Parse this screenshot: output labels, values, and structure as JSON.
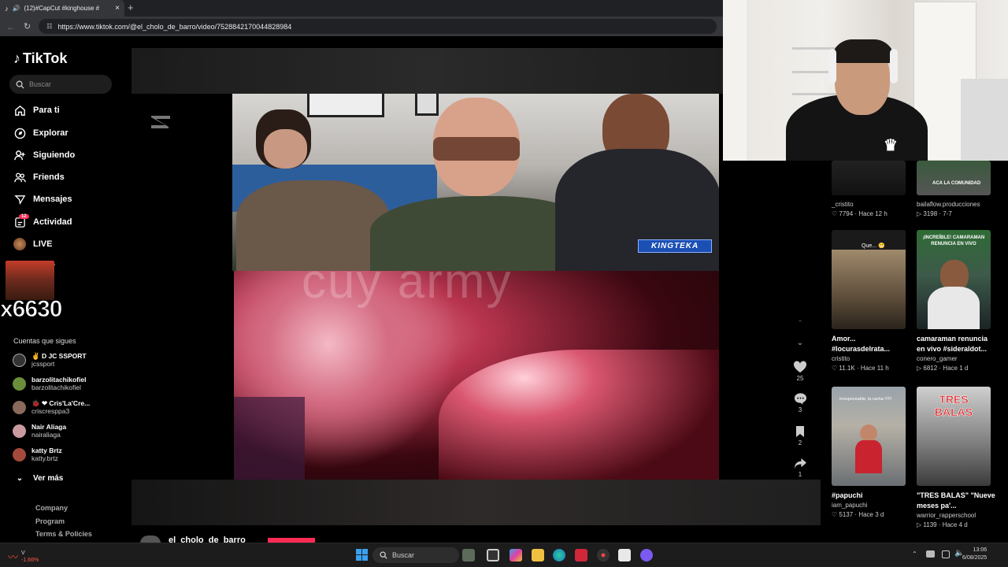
{
  "browser": {
    "tab_title": "(12)#CapCut #kinghouse #",
    "url": "https://www.tiktok.com/@el_cholo_de_barro/video/7528842170044828984"
  },
  "tiktok": {
    "logo": "TikTok",
    "search_placeholder": "Buscar",
    "nav": [
      {
        "label": "Para ti",
        "icon": "home-icon"
      },
      {
        "label": "Explorar",
        "icon": "compass-icon"
      },
      {
        "label": "Siguiendo",
        "icon": "following-icon"
      },
      {
        "label": "Friends",
        "icon": "friends-icon"
      },
      {
        "label": "Mensajes",
        "icon": "messages-icon"
      },
      {
        "label": "Actividad",
        "icon": "activity-icon"
      },
      {
        "label": "LIVE",
        "icon": "live-icon"
      }
    ],
    "activity_badge": "12",
    "partial_nav_text": "r",
    "overlay_number": "x6630",
    "following_header": "Cuentas que sigues",
    "accounts": [
      {
        "name": "✌ D JC SSPORT",
        "handle": "jcssport",
        "color": "#444"
      },
      {
        "name": "barzolitachikofiel",
        "handle": "barzolitachikofiel",
        "color": "#6b8e3a"
      },
      {
        "name": "🐞 ❤ Cris'La'Cre...",
        "handle": "criscresppa3",
        "color": "#8a6a5a"
      },
      {
        "name": "Nair Aliaga",
        "handle": "nairaliaga",
        "color": "#c99ba0"
      },
      {
        "name": "katty Brtz",
        "handle": "katty.brtz",
        "color": "#a34a3a"
      }
    ],
    "see_more": "Ver más",
    "footer": [
      "Company",
      "Program",
      "Terms & Policies"
    ]
  },
  "video": {
    "overlay_label": "KINGTEKA",
    "watermark": "cuy army",
    "author": "el_cholo_de_barro",
    "likes": "25",
    "comments": "3",
    "saves": "2",
    "shares": "1"
  },
  "grid": [
    {
      "title": "",
      "author": "_cristito",
      "views": "7794",
      "age": "Hace 12 h",
      "colors": [
        "#ddd",
        "#bbb"
      ]
    },
    {
      "title": "",
      "author": "bailaflow.producciones",
      "views": "3198",
      "age": "7-7",
      "colors": [
        "#2f5a33",
        "#1c2a1f"
      ],
      "thumb_text": "ACA LA COMUNIDAD"
    },
    {
      "title": "Amor... #locurasdelrata...",
      "author": "cristito",
      "views": "11.1K",
      "age": "Hace 11 h",
      "colors": [
        "#9c8a6e",
        "#3b3224"
      ],
      "thumb_text": "Que... 😬"
    },
    {
      "title": "camaraman renuncia en vivo #sideraldot...",
      "author": "conero_gamer",
      "views": "6812",
      "age": "Hace 1 d",
      "colors": [
        "#3b6d3f",
        "#1e2a2b"
      ],
      "thumb_text": "¡INCREÍBLE! CAMARAMAN RENUNCIA EN VIVO"
    },
    {
      "title": "#papuchi",
      "author": "iam_papuchi",
      "views": "5137",
      "age": "Hace 3 d",
      "colors": [
        "#9aa3ab",
        "#5c6168"
      ],
      "thumb_text": "irresponsable, la racha !!!!!!"
    },
    {
      "title": "\"TRES BALAS\" \"Nueve meses pa'...",
      "author": "warrior_rapperschool",
      "views": "1139",
      "age": "Hace 4 d",
      "colors": [
        "#d8d8d8",
        "#555"
      ],
      "thumb_text": "TRES BALAS"
    }
  ],
  "taskbar": {
    "weather_value": "-1.66%",
    "weather_label": "V",
    "search": "Buscar",
    "time": "13:06",
    "date": "6/08/2025"
  }
}
